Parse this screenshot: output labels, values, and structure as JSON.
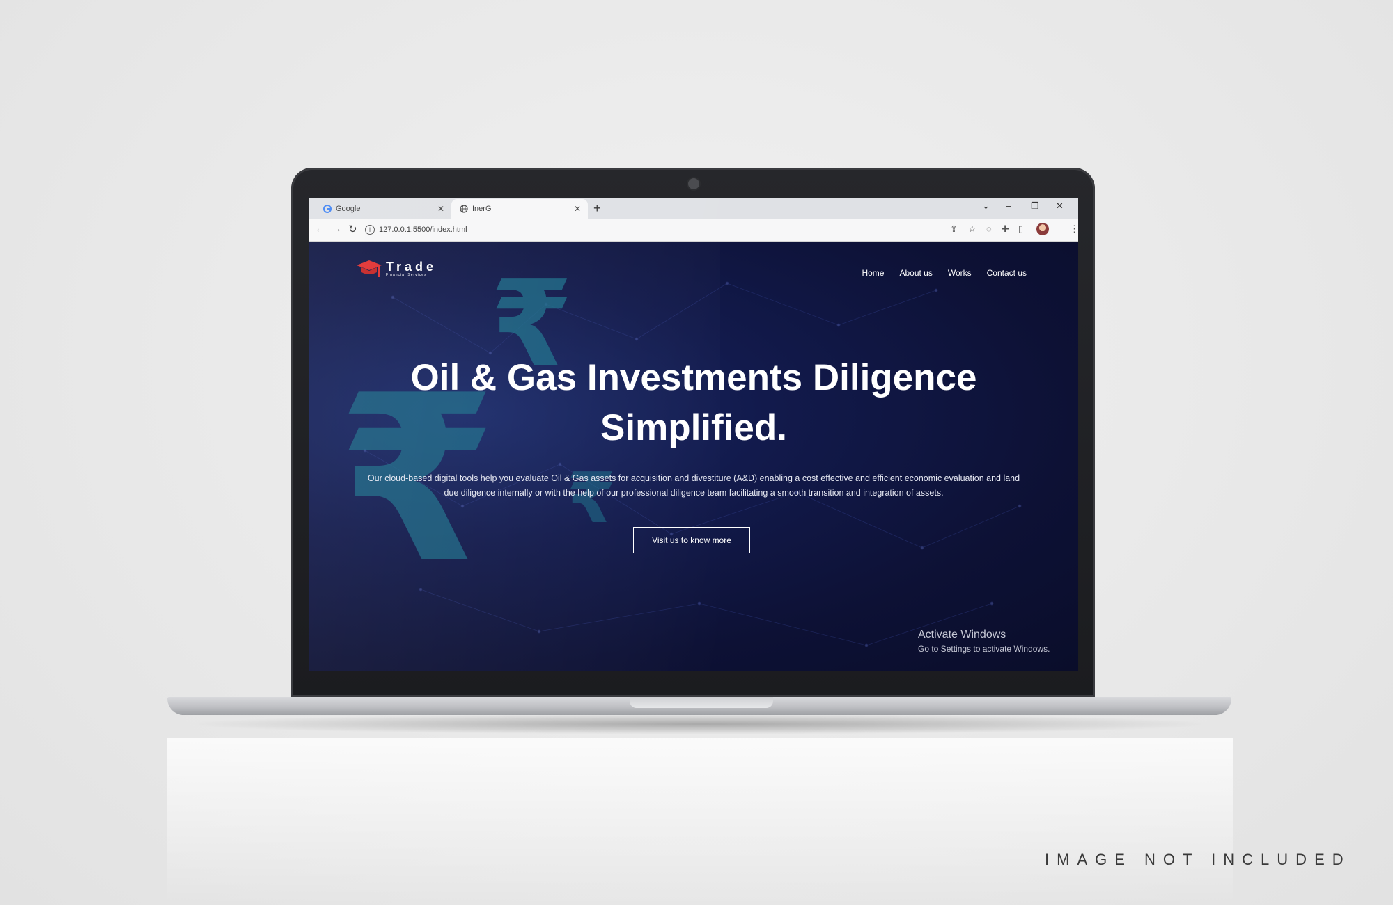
{
  "browser": {
    "tabs": [
      {
        "title": "Google",
        "active": false
      },
      {
        "title": "InerG",
        "active": true
      }
    ],
    "new_tab_label": "+",
    "address": "127.0.0.1:5500/index.html"
  },
  "site": {
    "logo_text": "Trade",
    "logo_subtext": "Financial Services",
    "nav": [
      "Home",
      "About us",
      "Works",
      "Contact us"
    ],
    "hero_title_line1": "Oil & Gas Investments Diligence",
    "hero_title_line2": "Simplified.",
    "hero_text_line1": "Our cloud-based digital tools help you evaluate Oil & Gas assets for acquisition and divestiture (A&D) enabling a cost effective and efficient economic evaluation and land",
    "hero_text_line2": "due diligence internally or with the help of our professional diligence team facilitating a smooth transition and integration of assets.",
    "cta_label": "Visit us to know more",
    "background_symbol": "₹"
  },
  "os_watermark": {
    "title": "Activate Windows",
    "subtitle": "Go to Settings to activate Windows."
  },
  "caption": "IMAGE NOT INCLUDED",
  "colors": {
    "site_bg": "#0e1234",
    "accent_rupee": "#1c6f8a",
    "logo_red": "#e03030"
  }
}
